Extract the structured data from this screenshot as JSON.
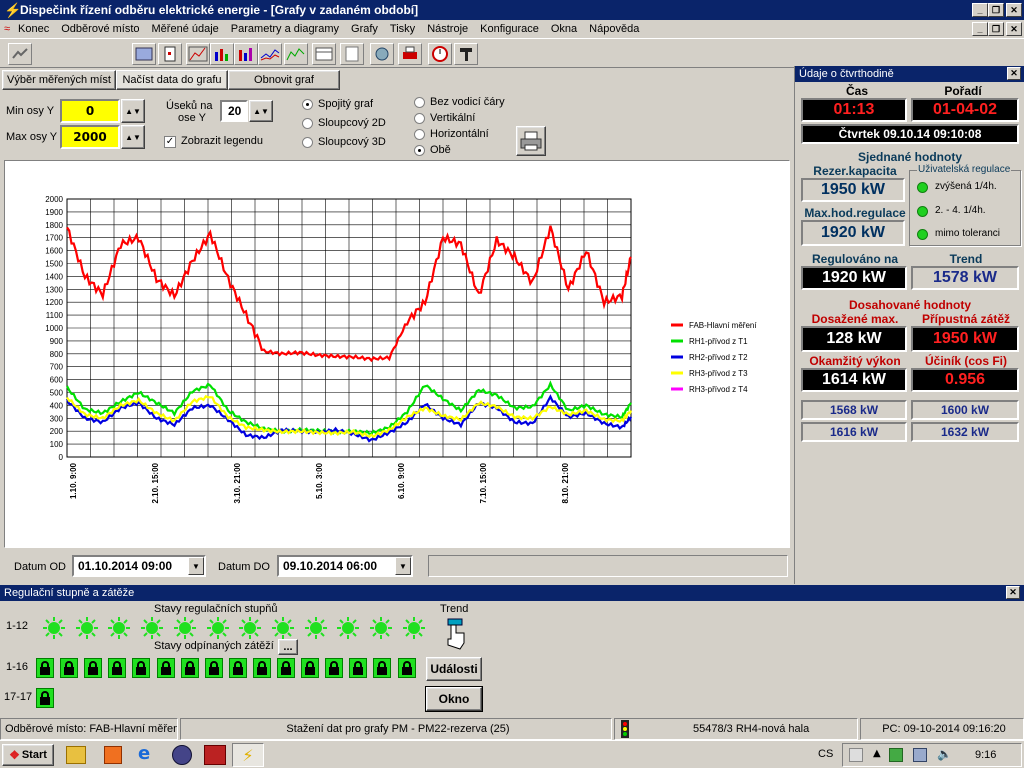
{
  "window": {
    "title": "Dispečink řízení odběru elektrické energie - [Grafy v zadaném období]"
  },
  "menu": [
    "Konec",
    "Odběrové místo",
    "Měřené údaje",
    "Parametry a diagramy",
    "Grafy",
    "Tisky",
    "Nástroje",
    "Konfigurace",
    "Okna",
    "Nápověda"
  ],
  "graph_panel": {
    "tabs": [
      "Výběr měřených míst",
      "Načíst data do grafu",
      "Obnovit graf"
    ],
    "min_axis_label": "Min osy Y",
    "min_axis_value": "0",
    "max_axis_label": "Max osy Y",
    "max_axis_value": "2000",
    "sections_label_1": "Úseků na",
    "sections_label_2": "ose Y",
    "sections_value": "20",
    "legend_check_label": "Zobrazit legendu",
    "graph_types": [
      "Spojitý graf",
      "Sloupcový 2D",
      "Sloupcový 3D"
    ],
    "guide_lines": [
      "Bez vodicí čáry",
      "Vertikální",
      "Horizontální",
      "Obě"
    ],
    "date_from_label": "Datum OD",
    "date_from": "01.10.2014 09:00",
    "date_to_label": "Datum DO",
    "date_to": "09.10.2014 06:00"
  },
  "chart_data": {
    "type": "line",
    "ylim": [
      0,
      2000
    ],
    "yticks": [
      "0",
      "100",
      "200",
      "300",
      "400",
      "500",
      "600",
      "700",
      "800",
      "900",
      "1000",
      "1100",
      "1200",
      "1300",
      "1400",
      "1500",
      "1600",
      "1700",
      "1800",
      "1900",
      "2000"
    ],
    "xtick_labels": [
      "1.10. 9:00",
      "2.10. 15:00",
      "3.10. 21:00",
      "5.10. 3:00",
      "6.10. 9:00",
      "7.10. 15:00",
      "8.10. 21:00"
    ],
    "x": [
      0,
      6,
      12,
      18,
      24,
      30,
      36,
      42,
      48,
      54,
      60,
      66,
      72,
      78,
      84,
      90,
      96,
      102,
      108,
      114,
      120,
      126,
      132,
      138,
      144,
      150,
      156,
      162,
      168,
      174,
      180,
      186,
      189
    ],
    "series": [
      {
        "name": "FAB-Hlavní měření",
        "color": "#ff0000",
        "values": [
          1780,
          1400,
          1260,
          1650,
          1700,
          1380,
          1250,
          1520,
          1730,
          1380,
          1100,
          820,
          800,
          810,
          790,
          780,
          775,
          760,
          770,
          1050,
          1200,
          1700,
          1650,
          1250,
          1680,
          1550,
          1350,
          1780,
          1300,
          1600,
          1200,
          1250,
          1550
        ]
      },
      {
        "name": "RH1-přívod z T1",
        "color": "#00e000",
        "values": [
          540,
          370,
          340,
          430,
          500,
          420,
          340,
          510,
          560,
          360,
          270,
          220,
          200,
          210,
          205,
          195,
          200,
          185,
          230,
          350,
          560,
          450,
          360,
          520,
          480,
          380,
          390,
          560,
          360,
          400,
          330,
          310,
          420
        ]
      },
      {
        "name": "RH2-přívod z T2",
        "color": "#0000e0",
        "values": [
          440,
          300,
          270,
          380,
          420,
          300,
          250,
          380,
          400,
          290,
          170,
          150,
          210,
          200,
          190,
          210,
          180,
          130,
          190,
          270,
          410,
          300,
          250,
          420,
          380,
          270,
          260,
          460,
          310,
          340,
          260,
          230,
          310
        ]
      },
      {
        "name": "RH3-přívod z T3",
        "color": "#ffff00",
        "values": [
          460,
          330,
          300,
          400,
          440,
          340,
          280,
          430,
          470,
          310,
          230,
          210,
          195,
          200,
          190,
          185,
          195,
          160,
          210,
          310,
          380,
          320,
          290,
          420,
          390,
          310,
          300,
          390,
          330,
          360,
          290,
          280,
          360
        ]
      },
      {
        "name": "RH3-přívod z T4",
        "color": "#ff00ff",
        "values": []
      }
    ]
  },
  "quarter_panel": {
    "title": "Údaje o čtvrthodině",
    "time_label": "Čas",
    "time_value": "01:13",
    "order_label": "Pořadí",
    "order_value": "01-04-02",
    "datetime_value": "Čtvrtek  09.10.14  09:10:08",
    "agreed_label": "Sjednané hodnoty",
    "reserved_label": "Rezer.kapacita",
    "reserved_value": "1950 kW",
    "maxreg_label": "Max.hod.regulace",
    "maxreg_value": "1920 kW",
    "user_reg_label": "Uživatelská regulace",
    "user_reg_items": [
      "zvýšená 1/4h.",
      "2. - 4. 1/4h.",
      "mimo toleranci"
    ],
    "regulated_label": "Regulováno na",
    "regulated_value": "1920 kW",
    "trend_label": "Trend",
    "trend_value": "1578 kW",
    "achieved_label": "Dosahované hodnoty",
    "achieved_max_label": "Dosažené max.",
    "achieved_max_value": "128 kW",
    "allowed_label": "Přípustná zátěž",
    "allowed_value": "1950 kW",
    "instant_label": "Okamžitý výkon",
    "instant_value": "1614 kW",
    "pf_label": "Účiník (cos Fi)",
    "pf_value": "0.956",
    "extra_values": [
      "1568 kW",
      "1600 kW",
      "1616 kW",
      "1632 kW"
    ]
  },
  "reg_panel": {
    "title": "Regulační stupně a zátěže",
    "states_label": "Stavy regulačních stupňů",
    "trend_label": "Trend",
    "loads_label": "Stavy odpínaných zátěží",
    "more_btn": "...",
    "row1_label": "1-12",
    "row2_label": "1-16",
    "row3_label": "17-17",
    "events_btn": "Události",
    "window_btn": "Okno"
  },
  "statusbar": {
    "place": "Odběrové místo: FAB-Hlavní měření",
    "download": "Stažení dat pro grafy PM - PM22-rezerva (25)",
    "device": "55478/3 RH4-nová hala",
    "pc_time": "PC: 09-10-2014 09:16:20"
  },
  "taskbar": {
    "start": "Start",
    "lang": "CS",
    "clock": "9:16"
  }
}
